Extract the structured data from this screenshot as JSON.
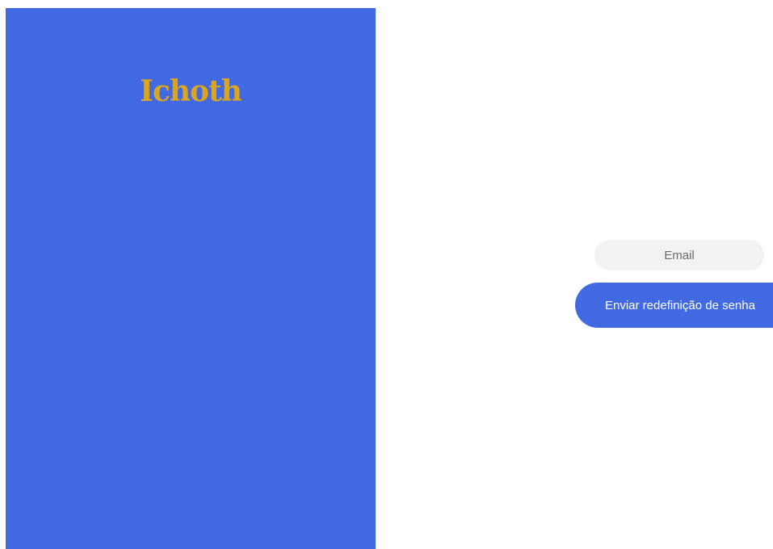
{
  "brand": {
    "logo_text": "Ichoth"
  },
  "form": {
    "email_placeholder": "Email",
    "email_value": "",
    "submit_label": "Enviar redefinição de senha"
  },
  "colors": {
    "brand_blue": "#4169e1",
    "logo_gold": "#daa520",
    "input_background": "#f2f2f2",
    "page_background": "#ffffff"
  }
}
